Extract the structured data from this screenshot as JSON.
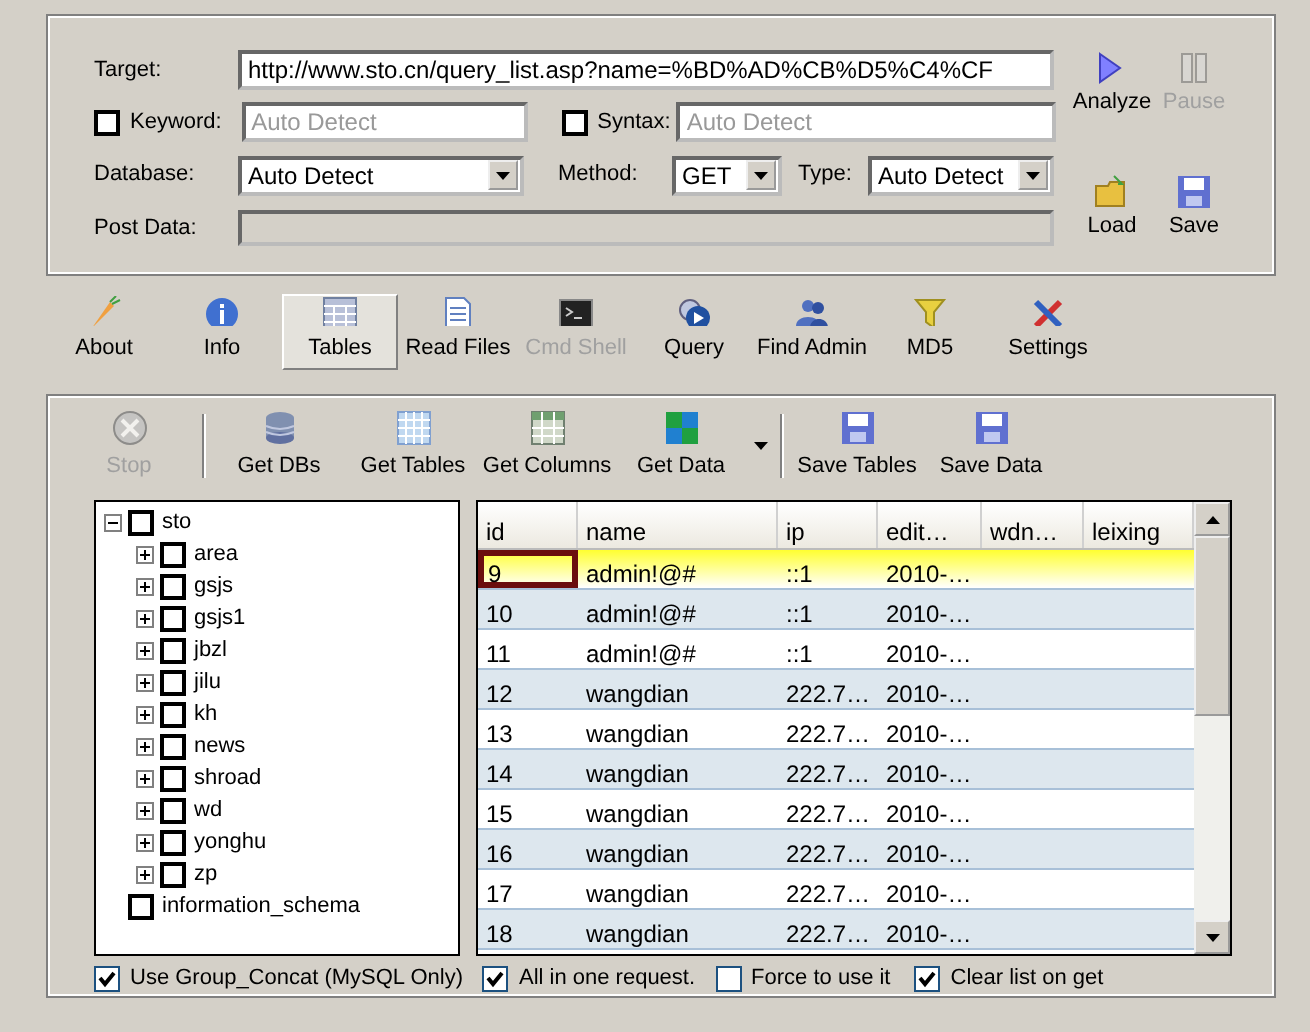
{
  "target": {
    "label": "Target:",
    "value": "http://www.sto.cn/query_list.asp?name=%BD%AD%CB%D5%C4%CF"
  },
  "keyword": {
    "label": "Keyword:",
    "checked": false,
    "placeholder": "Auto Detect"
  },
  "syntax": {
    "label": "Syntax:",
    "checked": false,
    "placeholder": "Auto Detect"
  },
  "database": {
    "label": "Database:",
    "value": "Auto Detect"
  },
  "method": {
    "label": "Method:",
    "value": "GET"
  },
  "type": {
    "label": "Type:",
    "value": "Auto Detect"
  },
  "post_data": {
    "label": "Post Data:"
  },
  "actions": [
    {
      "label": "Analyze",
      "disabled": false
    },
    {
      "label": "Pause",
      "disabled": true
    },
    {
      "label": "Load",
      "disabled": false
    },
    {
      "label": "Save",
      "disabled": false
    }
  ],
  "tabs": [
    {
      "label": "About",
      "selected": false,
      "disabled": false
    },
    {
      "label": "Info",
      "selected": false,
      "disabled": false
    },
    {
      "label": "Tables",
      "selected": true,
      "disabled": false
    },
    {
      "label": "Read Files",
      "selected": false,
      "disabled": false
    },
    {
      "label": "Cmd Shell",
      "selected": false,
      "disabled": true
    },
    {
      "label": "Query",
      "selected": false,
      "disabled": false
    },
    {
      "label": "Find Admin",
      "selected": false,
      "disabled": false
    },
    {
      "label": "MD5",
      "selected": false,
      "disabled": false
    },
    {
      "label": "Settings",
      "selected": false,
      "disabled": false
    }
  ],
  "toolbar": [
    {
      "kind": "button",
      "label": "Stop",
      "disabled": true
    },
    {
      "kind": "separator"
    },
    {
      "kind": "button",
      "label": "Get DBs",
      "disabled": false
    },
    {
      "kind": "button",
      "label": "Get Tables",
      "disabled": false
    },
    {
      "kind": "button",
      "label": "Get Columns",
      "disabled": false
    },
    {
      "kind": "button",
      "label": "Get Data",
      "disabled": false
    },
    {
      "kind": "dropdown"
    },
    {
      "kind": "separator"
    },
    {
      "kind": "button",
      "label": "Save Tables",
      "disabled": false
    },
    {
      "kind": "button",
      "label": "Save Data",
      "disabled": false
    }
  ],
  "tree": [
    {
      "label": "sto",
      "checked": false,
      "expanded": true,
      "children": [
        {
          "label": "area",
          "checked": false,
          "expanded": false
        },
        {
          "label": "gsjs",
          "checked": false,
          "expanded": false
        },
        {
          "label": "gsjs1",
          "checked": false,
          "expanded": false
        },
        {
          "label": "jbzl",
          "checked": false,
          "expanded": false
        },
        {
          "label": "jilu",
          "checked": false,
          "expanded": false
        },
        {
          "label": "kh",
          "checked": false,
          "expanded": false
        },
        {
          "label": "news",
          "checked": false,
          "expanded": false
        },
        {
          "label": "shroad",
          "checked": false,
          "expanded": false
        },
        {
          "label": "wd",
          "checked": false,
          "expanded": false
        },
        {
          "label": "yonghu",
          "checked": false,
          "expanded": false
        },
        {
          "label": "zp",
          "checked": false,
          "expanded": false
        }
      ]
    },
    {
      "label": "information_schema",
      "checked": false
    }
  ],
  "grid": {
    "columns": [
      "id",
      "name",
      "ip",
      "edit…",
      "wdn…",
      "leixing"
    ],
    "rows": [
      {
        "cells": [
          "9",
          "admin!@#",
          "::1",
          "2010-…"
        ],
        "selected": true
      },
      {
        "cells": [
          "10",
          "admin!@#",
          "::1",
          "2010-…"
        ],
        "selected": false
      },
      {
        "cells": [
          "11",
          "admin!@#",
          "::1",
          "2010-…"
        ],
        "selected": false
      },
      {
        "cells": [
          "12",
          "wangdian",
          "222.7…",
          "2010-…"
        ],
        "selected": false
      },
      {
        "cells": [
          "13",
          "wangdian",
          "222.7…",
          "2010-…"
        ],
        "selected": false
      },
      {
        "cells": [
          "14",
          "wangdian",
          "222.7…",
          "2010-…"
        ],
        "selected": false
      },
      {
        "cells": [
          "15",
          "wangdian",
          "222.7…",
          "2010-…"
        ],
        "selected": false
      },
      {
        "cells": [
          "16",
          "wangdian",
          "222.7…",
          "2010-…"
        ],
        "selected": false
      },
      {
        "cells": [
          "17",
          "wangdian",
          "222.7…",
          "2010-…"
        ],
        "selected": false
      },
      {
        "cells": [
          "18",
          "wangdian",
          "222.7…",
          "2010-…"
        ],
        "selected": false
      }
    ]
  },
  "options": [
    {
      "label": "Use Group_Concat (MySQL Only)",
      "checked": true
    },
    {
      "label": "All in one request.",
      "checked": true
    },
    {
      "label": "Force to use it",
      "checked": false
    },
    {
      "label": "Clear list on get",
      "checked": true
    }
  ]
}
